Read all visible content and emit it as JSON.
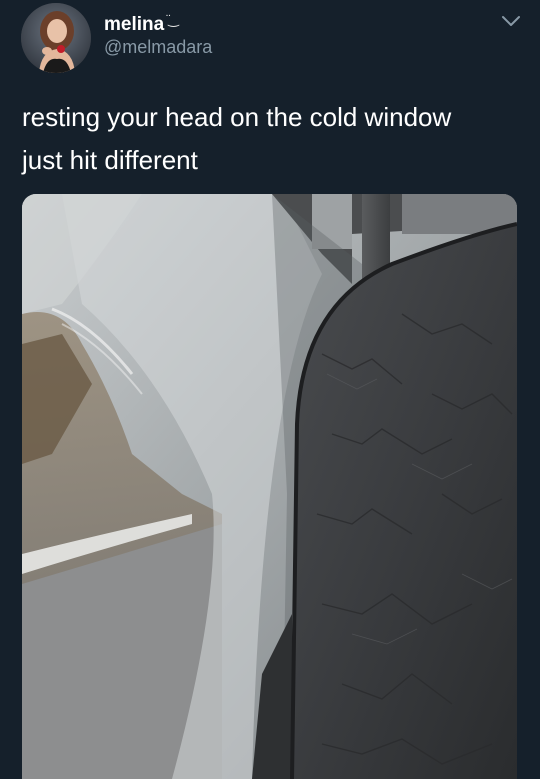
{
  "user": {
    "display_name": "melina",
    "name_emoji": "̈‿",
    "handle": "@melmadara",
    "avatar_icon": "profile-photo"
  },
  "header": {
    "menu_icon": "chevron-down-icon"
  },
  "tweet": {
    "text": "resting your head on the cold window\njust hit different"
  },
  "media": {
    "icon": "photo-bus-window-seat"
  },
  "colors": {
    "background": "#15202b",
    "text_primary": "#ffffff",
    "text_secondary": "#8899a6"
  }
}
